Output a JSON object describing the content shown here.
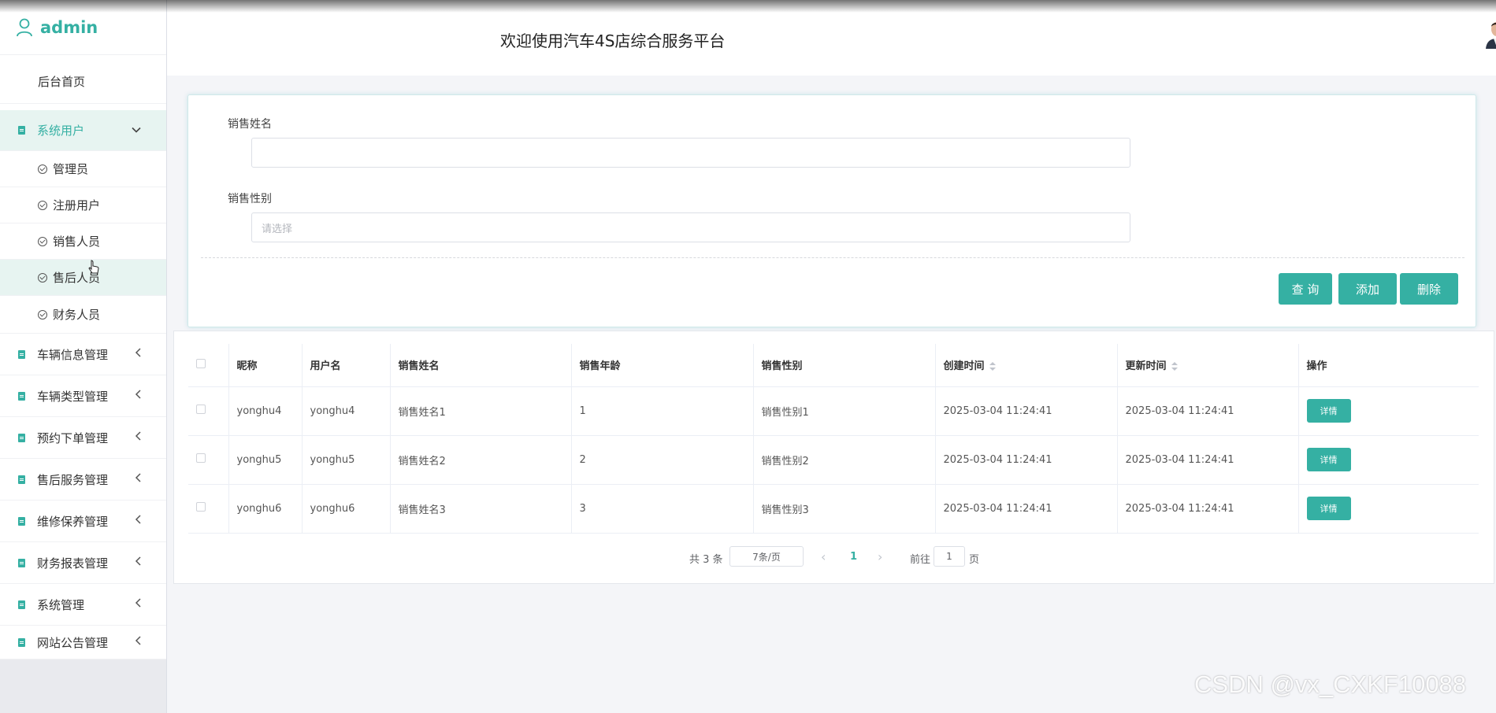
{
  "brand": {
    "name": "admin"
  },
  "header": {
    "title": "欢迎使用汽车4S店综合服务平台"
  },
  "sidebar": {
    "home": "后台首页",
    "system_users": {
      "label": "系统用户",
      "children": [
        "管理员",
        "注册用户",
        "销售人员",
        "售后人员",
        "财务人员"
      ]
    },
    "groups": [
      "车辆信息管理",
      "车辆类型管理",
      "预约下单管理",
      "售后服务管理",
      "维修保养管理",
      "财务报表管理",
      "系统管理",
      "网站公告管理"
    ]
  },
  "search": {
    "name_label": "销售姓名",
    "name_value": "",
    "gender_label": "销售性别",
    "gender_placeholder": "请选择",
    "query_btn": "查 询",
    "add_btn": "添加",
    "delete_btn": "删除"
  },
  "table": {
    "columns": [
      "昵称",
      "用户名",
      "销售姓名",
      "销售年龄",
      "销售性别",
      "创建时间",
      "更新时间",
      "操作"
    ],
    "rows": [
      [
        "yonghu4",
        "yonghu4",
        "销售姓名1",
        "1",
        "销售性别1",
        "2025-03-04 11:24:41",
        "2025-03-04 11:24:41"
      ],
      [
        "yonghu5",
        "yonghu5",
        "销售姓名2",
        "2",
        "销售性别2",
        "2025-03-04 11:24:41",
        "2025-03-04 11:24:41"
      ],
      [
        "yonghu6",
        "yonghu6",
        "销售姓名3",
        "3",
        "销售性别3",
        "2025-03-04 11:24:41",
        "2025-03-04 11:24:41"
      ]
    ],
    "detail_btn": "详情"
  },
  "pagination": {
    "total": "共 3 条",
    "page_size": "7条/页",
    "prev": "‹",
    "current": "1",
    "next": "›",
    "goto_label": "前往",
    "goto_value": "1",
    "page_unit": "页"
  },
  "watermark": "CSDN @vx_CXKF10088",
  "colors": {
    "accent": "#35b0a3"
  }
}
